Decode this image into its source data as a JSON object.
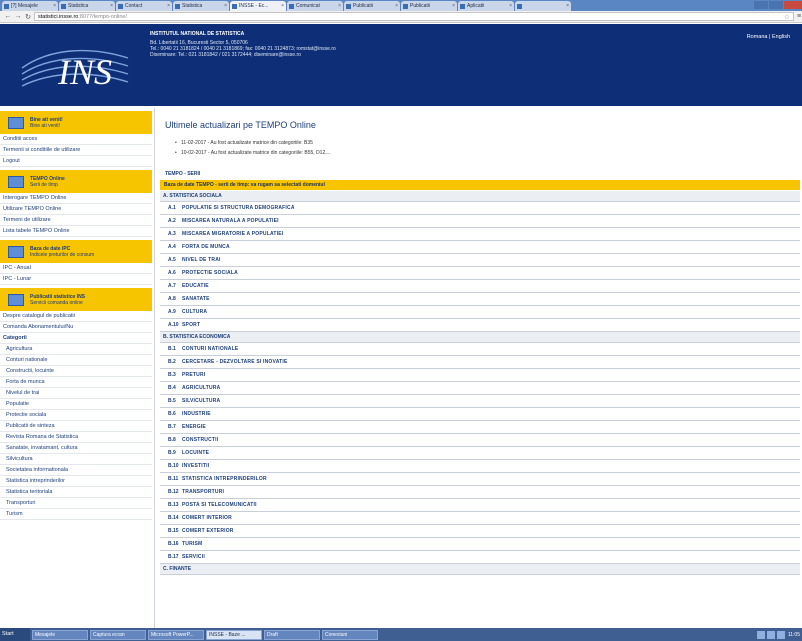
{
  "browser": {
    "tabs": [
      {
        "label": "[?] Mesajele",
        "active": false
      },
      {
        "label": "Statistica",
        "active": false
      },
      {
        "label": "Contact",
        "active": false
      },
      {
        "label": "Statistica",
        "active": false
      },
      {
        "label": "INSSE - Ec...",
        "active": true
      },
      {
        "label": "Comunicat",
        "active": false
      },
      {
        "label": "Publicatii",
        "active": false
      },
      {
        "label": "Publicatii",
        "active": false
      },
      {
        "label": "Aplicatii",
        "active": false
      },
      {
        "label": "",
        "active": false
      }
    ],
    "url_host": "statistici.insse.ro",
    "url_path": ":8077/tempo-online/"
  },
  "header": {
    "logo_text": "INS",
    "institute_name": "INSTITUTUL NATIONAL DE STATISTICA",
    "address_lines": [
      "Bd. Libertatii 16, Bucuresti Sector 5, 050706",
      "Tel.: 0040 21 3181824 / 0040 21 3181869; fax: 0040 21 3124873; romstat@insse.ro",
      "Diseminare: Tel.: 021 3181842 / 021 3172444; diseminare@insse.ro"
    ],
    "top_right": "Romana | English"
  },
  "sidebar": {
    "block1": {
      "title": "Bine ati venit!",
      "subtitle": "Bine ati venit!"
    },
    "block1_links": [
      "Conditii acces",
      "Termenii si conditiile de utilizare",
      "Logout"
    ],
    "block2": {
      "title": "TEMPO Online",
      "subtitle": "Serii de timp"
    },
    "block2_links": [
      "Interogare TEMPO Online",
      "Utilizare TEMPO Online",
      "Termeni de utilizare",
      "Lista tabele TEMPO Online"
    ],
    "block3": {
      "title": "Baza de date IPC",
      "subtitle": "Indicele preturilor de consum"
    },
    "block3_links": [
      "IPC - Anual",
      "IPC - Lunar"
    ],
    "block4": {
      "title": "Publicatii statistice INS",
      "subtitle": "Servicii comanda online"
    },
    "block4_links": [
      "Despre catalogul de publicatii",
      "Comanda Abonamentului/Nu"
    ],
    "categories_title": "Categorii",
    "categories": [
      "Agricultura",
      "Conturi nationale",
      "Constructii, locuinte",
      "Forta de munca",
      "Nivelul de trai",
      "Populatie",
      "Protectie sociala",
      "Publicatii de sinteza",
      "Revista Romana de Statistica",
      "Sanatate, invatamant, cultura",
      "Silvicultura",
      "Societatea informationala",
      "Statistica intreprinderilor",
      "Statistica teritoriala",
      "Transporturi",
      "Turism"
    ]
  },
  "main": {
    "title": "Ultimele actualizari pe TEMPO Online",
    "news": [
      "11-02-2017 - Au fost actualizate matrice din categoriile: B35",
      "10-02-2017 - Au fost actualizate matrice din categoriile: B55, D12,..."
    ],
    "tempo_label": "TEMPO - SERII",
    "tempo_bar": "Baza de date TEMPO - serii de timp: va rugam sa selectati domeniul",
    "sections": [
      {
        "title": "A. STATISTICA SOCIALA",
        "rows": [
          {
            "code": "A.1",
            "name": "POPULATIE SI STRUCTURA DEMOGRAFICA"
          },
          {
            "code": "A.2",
            "name": "MISCAREA NATURALA A POPULATIEI"
          },
          {
            "code": "A.3",
            "name": "MISCAREA MIGRATORIE A POPULATIEI"
          },
          {
            "code": "A.4",
            "name": "FORTA DE MUNCA"
          },
          {
            "code": "A.5",
            "name": "NIVEL DE TRAI"
          },
          {
            "code": "A.6",
            "name": "PROTECTIE SOCIALA"
          },
          {
            "code": "A.7",
            "name": "EDUCATIE"
          },
          {
            "code": "A.8",
            "name": "SANATATE"
          },
          {
            "code": "A.9",
            "name": "CULTURA"
          },
          {
            "code": "A.10",
            "name": "SPORT"
          }
        ]
      },
      {
        "title": "B. STATISTICA ECONOMICA",
        "rows": [
          {
            "code": "B.1",
            "name": "CONTURI NATIONALE"
          },
          {
            "code": "B.2",
            "name": "CERCETARE - DEZVOLTARE SI INOVATIE"
          },
          {
            "code": "B.3",
            "name": "PRETURI"
          },
          {
            "code": "B.4",
            "name": "AGRICULTURA"
          },
          {
            "code": "B.5",
            "name": "SILVICULTURA"
          },
          {
            "code": "B.6",
            "name": "INDUSTRIE"
          },
          {
            "code": "B.7",
            "name": "ENERGIE"
          },
          {
            "code": "B.8",
            "name": "CONSTRUCTII"
          },
          {
            "code": "B.9",
            "name": "LOCUINTE"
          },
          {
            "code": "B.10",
            "name": "INVESTITII"
          },
          {
            "code": "B.11",
            "name": "STATISTICA INTREPRINDERILOR"
          },
          {
            "code": "B.12",
            "name": "TRANSPORTURI"
          },
          {
            "code": "B.13",
            "name": "POSTA SI TELECOMUNICATII"
          },
          {
            "code": "B.14",
            "name": "COMERT INTERIOR"
          },
          {
            "code": "B.15",
            "name": "COMERT EXTERIOR"
          },
          {
            "code": "B.16",
            "name": "TURISM"
          },
          {
            "code": "B.17",
            "name": "SERVICII"
          }
        ]
      },
      {
        "title": "C. FINANTE",
        "rows": []
      }
    ]
  },
  "taskbar": {
    "start": "Start",
    "items": [
      {
        "label": "Mesajele",
        "active": false
      },
      {
        "label": "Captura ecran",
        "active": false
      },
      {
        "label": "Microsoft PowerP...",
        "active": false
      },
      {
        "label": "INSSE - Baze ...",
        "active": true
      },
      {
        "label": "Draft",
        "active": false
      },
      {
        "label": "Conexiuni",
        "active": false
      }
    ],
    "clock": "11:05"
  }
}
